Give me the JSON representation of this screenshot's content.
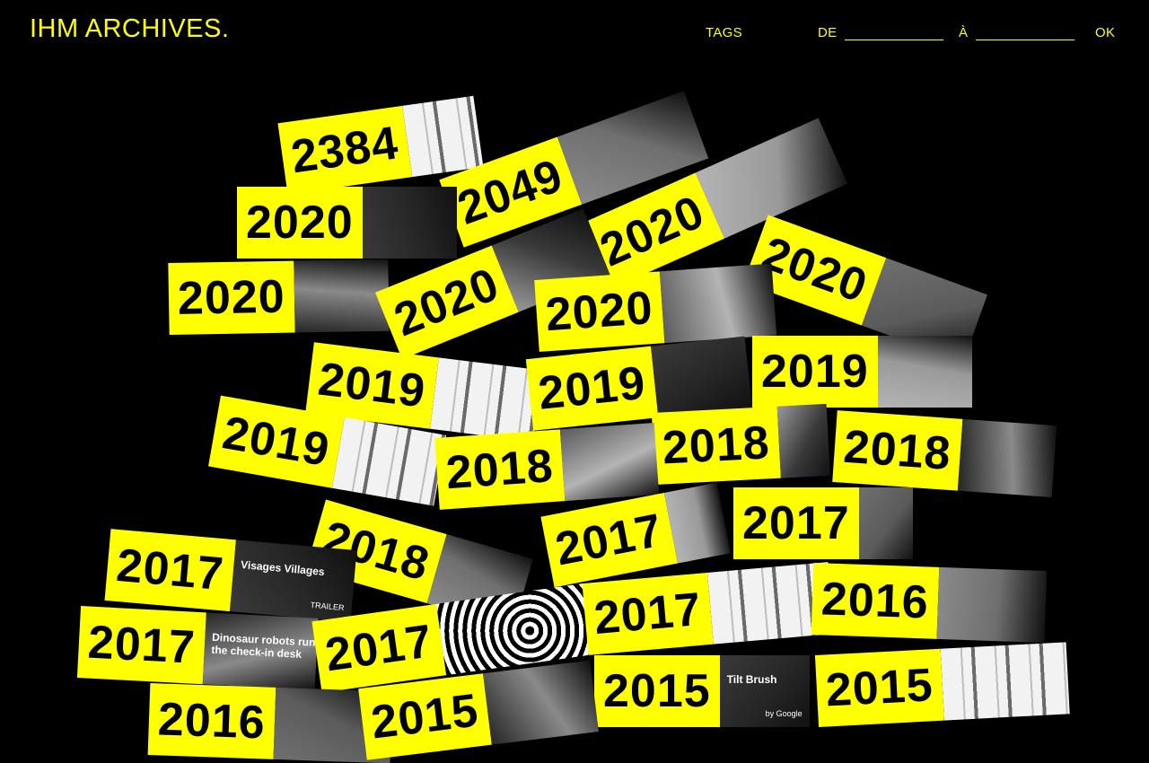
{
  "header": {
    "logo": "IHM ARCHIVES.",
    "tags_label": "TAGS",
    "from_label": "DE",
    "to_label": "À",
    "ok_label": "OK"
  },
  "colors": {
    "accent": "#ffff00",
    "background": "#000000"
  },
  "cards": [
    {
      "year": "2384",
      "thumb": "diagram"
    },
    {
      "year": "2049",
      "thumb": "photo"
    },
    {
      "year": "2020",
      "thumb": "photo"
    },
    {
      "year": "2020",
      "thumb": "photo"
    },
    {
      "year": "2020",
      "thumb": "photo"
    },
    {
      "year": "2020",
      "thumb": "photo"
    },
    {
      "year": "2020",
      "thumb": "photo"
    },
    {
      "year": "2020",
      "thumb": "photo"
    },
    {
      "year": "2019",
      "thumb": "diagram"
    },
    {
      "year": "2019",
      "thumb": "photo"
    },
    {
      "year": "2019",
      "thumb": "photo"
    },
    {
      "year": "2019",
      "thumb": "diagram"
    },
    {
      "year": "2018",
      "thumb": "photo"
    },
    {
      "year": "2018",
      "thumb": "photo"
    },
    {
      "year": "2018",
      "thumb": "photo"
    },
    {
      "year": "2018",
      "thumb": "photo"
    },
    {
      "year": "2017",
      "thumb": "photo",
      "caption": "Visages Villages",
      "caption2": "TRAILER"
    },
    {
      "year": "2017",
      "thumb": "photo"
    },
    {
      "year": "2017",
      "thumb": "photo"
    },
    {
      "year": "2017",
      "thumb": "photo",
      "caption": "Dinosaur robots run the check-in desk"
    },
    {
      "year": "2017",
      "thumb": "pattern"
    },
    {
      "year": "2017",
      "thumb": "diagram"
    },
    {
      "year": "2016",
      "thumb": "photo"
    },
    {
      "year": "2015",
      "thumb": "photo",
      "caption": "Tilt Brush",
      "caption2": "by Google"
    },
    {
      "year": "2015",
      "thumb": "diagram"
    },
    {
      "year": "2016",
      "thumb": "photo"
    },
    {
      "year": "2015",
      "thumb": "photo"
    }
  ]
}
